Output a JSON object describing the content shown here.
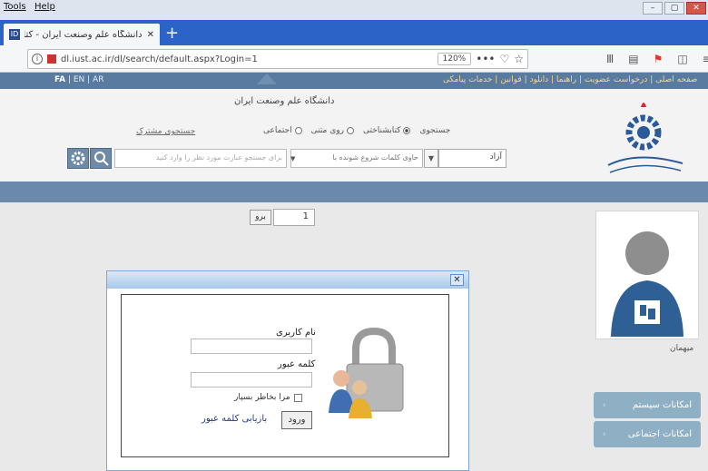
{
  "browser": {
    "menu": [
      "Tools",
      "Help"
    ],
    "tab_title": "دانشگاه علم وصنعت ایران - کتابخان...",
    "url": "dl.iust.ac.ir/dl/search/default.aspx?Login=1",
    "zoom": "120%"
  },
  "site": {
    "languages": [
      "FA",
      "EN",
      "AR"
    ],
    "top_links": "صفحه اصلی | درخواست عضویت | راهنما | دانلود | قوانین | خدمات پیامکی",
    "university_name": "دانشگاه علم وصنعت ایران",
    "search_label": "جستجوی",
    "radio_options": [
      "کتابشناختی",
      "روی متنی",
      "اجتماعی"
    ],
    "joint_search": "جستجوی مشترک",
    "free_label": "آزاد",
    "filter_option": "حاوی کلمات شروع شونده با",
    "search_placeholder": "برای جستجو عبارت مورد نظر را وارد کنید",
    "pager_go": "برو",
    "pager_value": "1",
    "guest_label": "میهمان",
    "side_buttons": [
      "امکانات سیستم",
      "امکانات اجتماعی"
    ]
  },
  "login": {
    "username_label": "نام کاربری",
    "password_label": "کلمه عبور",
    "remember_label": "مرا بخاطر بسپار",
    "login_button": "ورود",
    "recover_link": "بازیابی کلمه عبور",
    "close": "✕"
  },
  "colors": {
    "tabstrip": "#2b63c6",
    "site_bar": "#6a89ab",
    "side_button": "#8fb0c4",
    "link": "#273a8a"
  }
}
